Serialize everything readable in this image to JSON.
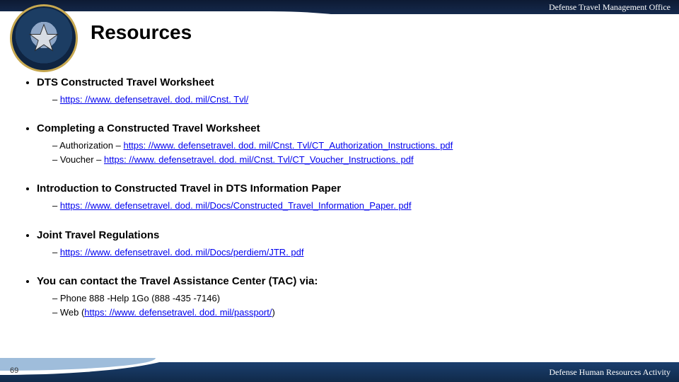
{
  "header": {
    "org_label": "Defense Travel Management Office",
    "title": "Resources"
  },
  "items": [
    {
      "heading": "DTS Constructed Travel Worksheet",
      "sub": [
        {
          "prefix": "",
          "link": "https: //www. defensetravel. dod. mil/Cnst. Tvl/",
          "suffix": ""
        }
      ]
    },
    {
      "heading": "Completing a Constructed Travel Worksheet",
      "sub": [
        {
          "prefix": "Authorization – ",
          "link": "https: //www. defensetravel. dod. mil/Cnst. Tvl/CT_Authorization_Instructions. pdf",
          "suffix": ""
        },
        {
          "prefix": "Voucher – ",
          "link": "https: //www. defensetravel. dod. mil/Cnst. Tvl/CT_Voucher_Instructions. pdf",
          "suffix": ""
        }
      ]
    },
    {
      "heading": "Introduction to Constructed Travel in DTS Information Paper",
      "sub": [
        {
          "prefix": "",
          "link": "https: //www. defensetravel. dod. mil/Docs/Constructed_Travel_Information_Paper. pdf",
          "suffix": ""
        }
      ]
    },
    {
      "heading": "Joint Travel Regulations",
      "sub": [
        {
          "prefix": "",
          "link": "https: //www. defensetravel. dod. mil/Docs/perdiem/JTR. pdf",
          "suffix": ""
        }
      ]
    },
    {
      "heading": "You can contact the Travel Assistance Center (TAC) via:",
      "sub": [
        {
          "prefix": "Phone 888 -Help 1Go (888 -435 -7146)",
          "link": "",
          "suffix": ""
        },
        {
          "prefix": "Web (",
          "link": "https: //www. defensetravel. dod. mil/passport/",
          "suffix": ")"
        }
      ]
    }
  ],
  "footer": {
    "page_number": "69",
    "org_label": "Defense Human Resources Activity"
  }
}
